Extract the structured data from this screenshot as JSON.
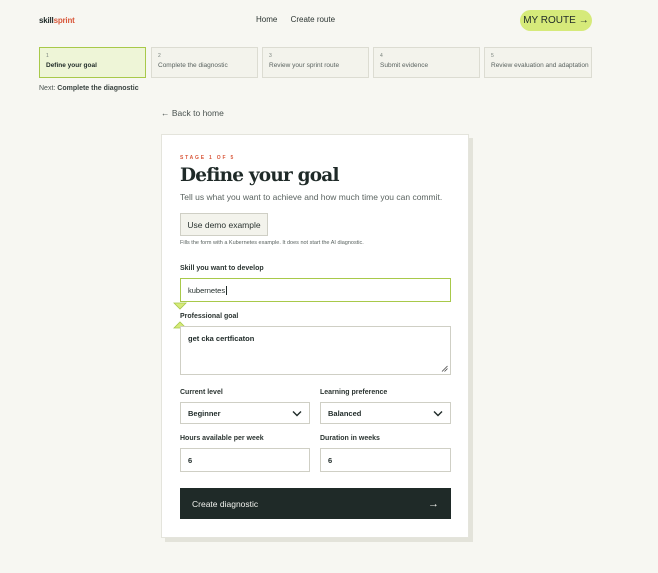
{
  "header": {
    "logo_part1": "skill",
    "logo_part2": "sprint",
    "nav": [
      "Home",
      "Create route"
    ],
    "route_button": "MY ROUTE",
    "route_arrow": "→"
  },
  "steps": [
    {
      "num": "1",
      "label": "Define your goal",
      "active": true
    },
    {
      "num": "2",
      "label": "Complete the diagnostic"
    },
    {
      "num": "3",
      "label": "Review your sprint route"
    },
    {
      "num": "4",
      "label": "Submit evidence"
    },
    {
      "num": "5",
      "label": "Review evaluation and adaptation"
    }
  ],
  "next_hint": {
    "prefix": "Next:",
    "value": "Complete the diagnostic"
  },
  "back_link": "← Back to home",
  "form": {
    "stage": "STAGE 1 OF 5",
    "title": "Define your goal",
    "subtitle": "Tell us what you want to achieve and how much time you can commit.",
    "demo_button": "Use demo example",
    "demo_note": "Fills the form with a Kubernetes example. It does not start the AI diagnostic.",
    "skill_label": "Skill you want to develop",
    "skill_value": "kubernetes",
    "goal_label": "Professional goal",
    "goal_value": "get cka certficaton",
    "level_label": "Current level",
    "level_value": "Beginner",
    "pref_label": "Learning preference",
    "pref_value": "Balanced",
    "hours_label": "Hours available per week",
    "hours_value": "6",
    "duration_label": "Duration in weeks",
    "duration_value": "6",
    "submit_label": "Create diagnostic",
    "submit_arrow": "→"
  },
  "colors": {
    "accent": "#d6ea7a",
    "focus": "#a8c94a",
    "brand_orange": "#d9583b",
    "dark": "#1f2a28",
    "background": "#f7f7f2"
  }
}
